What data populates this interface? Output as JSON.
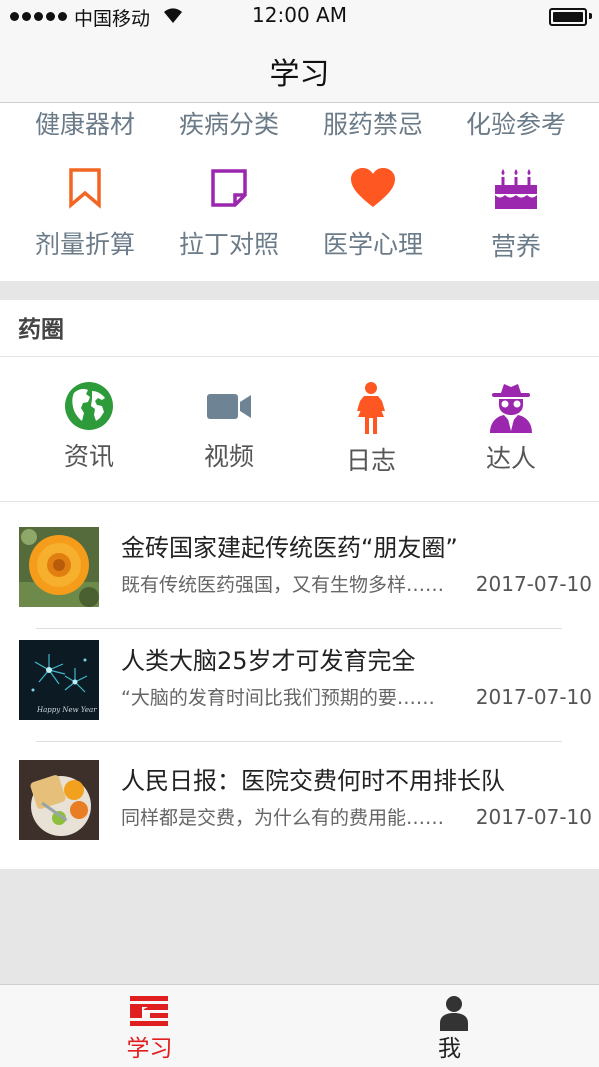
{
  "status_bar": {
    "carrier": "中国移动",
    "time": "12:00 AM"
  },
  "nav": {
    "title": "学习"
  },
  "grid": {
    "row1": [
      "健康器材",
      "疾病分类",
      "服药禁忌",
      "化验参考"
    ],
    "row2": [
      {
        "label": "剂量折算",
        "icon": "bookmark-icon",
        "color": "#f26522"
      },
      {
        "label": "拉丁对照",
        "icon": "note-icon",
        "color": "#9b27af"
      },
      {
        "label": "医学心理",
        "icon": "heart-icon",
        "color": "#ff5722"
      },
      {
        "label": "营养",
        "icon": "cake-icon",
        "color": "#9b27af"
      }
    ]
  },
  "circle": {
    "title": "药圈",
    "items": [
      {
        "label": "资讯",
        "icon": "globe-icon",
        "color": "#2e9b3a"
      },
      {
        "label": "视频",
        "icon": "video-camera-icon",
        "color": "#6e8494"
      },
      {
        "label": "日志",
        "icon": "woman-icon",
        "color": "#ff5722"
      },
      {
        "label": "达人",
        "icon": "spy-icon",
        "color": "#9b27af"
      }
    ]
  },
  "news": [
    {
      "title": "金砖国家建起传统医药“朋友圈”",
      "summary": "既有传统医药强国，又有生物多样……",
      "date": "2017-07-10",
      "thumb": "sunflower-image"
    },
    {
      "title": "人类大脑25岁才可发育完全",
      "summary": "“大脑的发育时间比我们预期的要……",
      "date": "2017-07-10",
      "thumb": "fireworks-image"
    },
    {
      "title": "人民日报：医院交费何时不用排长队",
      "summary": "同样都是交费，为什么有的费用能……",
      "date": "2017-07-10",
      "thumb": "breakfast-image"
    }
  ],
  "tabs": [
    {
      "label": "学习",
      "icon": "study-icon",
      "active": true,
      "color": "#e02020"
    },
    {
      "label": "我",
      "icon": "person-icon",
      "active": false,
      "color": "#333333"
    }
  ],
  "colors": {
    "accent": "#e02020",
    "grid_label": "#6b7b88"
  }
}
